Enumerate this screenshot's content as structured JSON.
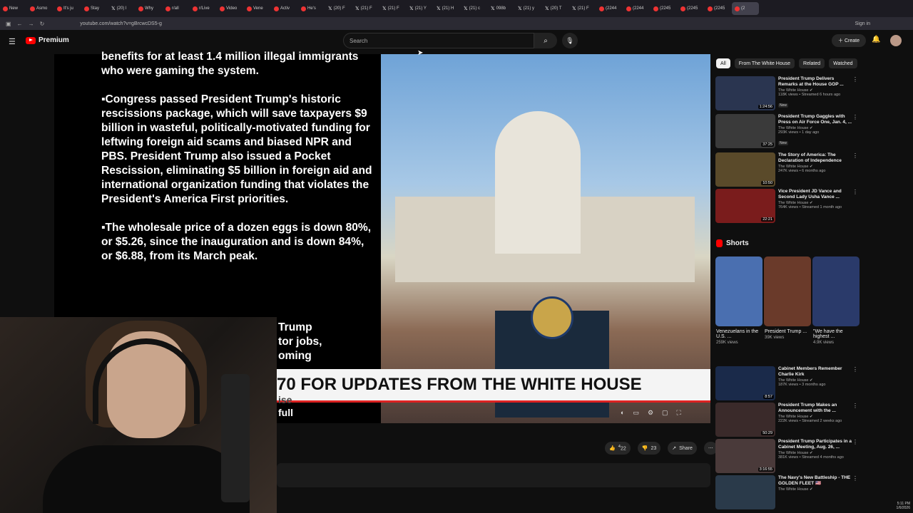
{
  "browser": {
    "tabs": [
      {
        "label": "New",
        "kind": "dot"
      },
      {
        "label": "Asmo",
        "kind": "dot"
      },
      {
        "label": "It's ju",
        "kind": "dot"
      },
      {
        "label": "Stay",
        "kind": "dot"
      },
      {
        "label": "(20) l",
        "kind": "x"
      },
      {
        "label": "Why",
        "kind": "dot"
      },
      {
        "label": "r/all",
        "kind": "dot"
      },
      {
        "label": "r/Live",
        "kind": "dot"
      },
      {
        "label": "Video",
        "kind": "dot"
      },
      {
        "label": "Vene",
        "kind": "dot"
      },
      {
        "label": "Activ",
        "kind": "dot"
      },
      {
        "label": "He's",
        "kind": "dot"
      },
      {
        "label": "(20) F",
        "kind": "x"
      },
      {
        "label": "(21) F",
        "kind": "x"
      },
      {
        "label": "(21) F",
        "kind": "x"
      },
      {
        "label": "(21) Y",
        "kind": "x"
      },
      {
        "label": "(21) H",
        "kind": "x"
      },
      {
        "label": "(21) c",
        "kind": "x"
      },
      {
        "label": "098b",
        "kind": "x"
      },
      {
        "label": "(21) y",
        "kind": "x"
      },
      {
        "label": "(20) T",
        "kind": "x"
      },
      {
        "label": "(21) F",
        "kind": "x"
      },
      {
        "label": "(2244",
        "kind": "dot"
      },
      {
        "label": "(2244",
        "kind": "dot"
      },
      {
        "label": "(2245",
        "kind": "dot"
      },
      {
        "label": "(2245",
        "kind": "dot"
      },
      {
        "label": "(2245",
        "kind": "dot"
      },
      {
        "label": "(2",
        "kind": "dot"
      }
    ],
    "url": "youtube.com/watch?v=gBrcwcDS5-g",
    "sign_in": "Sign in"
  },
  "youtube": {
    "logo": "Premium",
    "search_placeholder": "Search",
    "create_label": "Create",
    "notif_badge": "9+"
  },
  "video": {
    "text_paragraphs": [
      "benefits for at least 1.4 million illegal immigrants who were gaming the system.",
      "▪Congress passed President Trump's historic rescissions package, which will save taxpayers $9 billion in wasteful, politically-motivated funding for leftwing foreign aid scams and biased NPR and PBS. President Trump also issued a Pocket Rescission, eliminating $5 billion in foreign aid and international organization funding that violates the President's America First priorities.",
      "▪The wholesale price of a dozen eggs is down 80%, or $5.26, since the inauguration and is down 84%, or $6.88, from its March peak."
    ],
    "partial_text": [
      "Trump",
      "tor jobs,",
      "oming"
    ],
    "bottom_partial": [
      "ise",
      "full"
    ],
    "caption": "70 FOR UPDATES FROM THE WHITE HOUSE"
  },
  "actions": {
    "like_count": "22",
    "like_sup": "4",
    "dislike_count": "23",
    "share_label": "Share"
  },
  "sidebar": {
    "chips": [
      "All",
      "From The White House",
      "Related",
      "Watched"
    ],
    "recs_top": [
      {
        "title": "President Trump Delivers Remarks at the House GOP ...",
        "channel": "The White House",
        "views": "118K views • Streamed 6 hours ago",
        "badge": "New",
        "duration": "1:24:56",
        "color": "#2a3550"
      },
      {
        "title": "President Trump Gaggles with Press on Air Force One, Jan. 4, ...",
        "channel": "The White House",
        "views": "293K views • 1 day ago",
        "badge": "New",
        "duration": "37:25",
        "color": "#3a3a3a"
      },
      {
        "title": "The Story of America: The Declaration of Independence",
        "channel": "The White House",
        "views": "247K views • 6 months ago",
        "badge": "",
        "duration": "10:50",
        "color": "#5a4a2a"
      },
      {
        "title": "Vice President JD Vance and Second Lady Usha Vance ...",
        "channel": "The White House",
        "views": "764K views • Streamed 1 month ago",
        "badge": "",
        "duration": "22:21",
        "color": "#7a1c1c"
      }
    ],
    "shorts_label": "Shorts",
    "shorts": [
      {
        "title": "Venezuelans in the U.S. ...",
        "views": "259K views",
        "color": "#4a6fb0"
      },
      {
        "title": "President Trump ...",
        "views": "39K views",
        "color": "#6a3a2a"
      },
      {
        "title": "\"We have the highest ...",
        "views": "4.9K views",
        "color": "#2a3a6a"
      }
    ],
    "recs_bottom": [
      {
        "title": "Cabinet Members Remember Charlie Kirk",
        "channel": "The White House",
        "views": "187K views • 3 months ago",
        "duration": "8:57",
        "color": "#1a2a4a"
      },
      {
        "title": "President Trump Makes an Announcement with the ...",
        "channel": "The White House",
        "views": "222K views • Streamed 2 weeks ago",
        "duration": "50:29",
        "color": "#3a2a2a"
      },
      {
        "title": "President Trump Participates in a Cabinet Meeting, Aug. 26, ...",
        "channel": "The White House",
        "views": "381K views • Streamed 4 months ago",
        "duration": "3:16:55",
        "color": "#4a3a3a"
      },
      {
        "title": "The Navy's New Battleship - THE GOLDEN FLEET 🇺🇸",
        "channel": "The White House",
        "views": "",
        "duration": "",
        "color": "#2a3a4a"
      }
    ]
  },
  "system": {
    "time": "5:11 PM",
    "date": "1/6/2026"
  }
}
